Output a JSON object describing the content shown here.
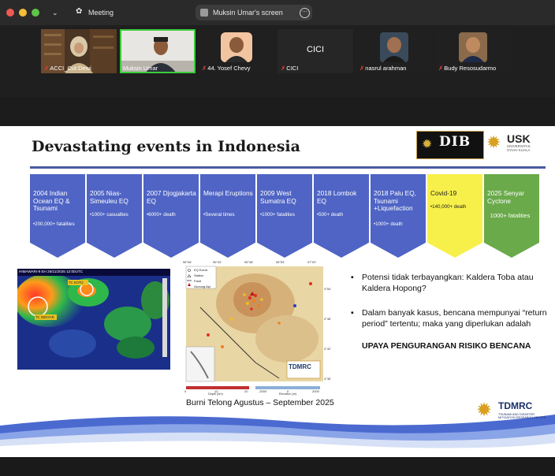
{
  "window": {
    "meeting_label": "Meeting",
    "share_title": "Muksin Umar's screen"
  },
  "participants": [
    {
      "name": "ACCI_Cut Dewi",
      "muted": true
    },
    {
      "name": "Muksin Umar",
      "muted": false
    },
    {
      "name": "44. Yosef Chevy",
      "muted": true
    },
    {
      "name": "CICI",
      "muted": true,
      "center_label": "CICI"
    },
    {
      "name": "nasrul arahman",
      "muted": true
    },
    {
      "name": "Budy Resosudarmo",
      "muted": true
    }
  ],
  "slide": {
    "title": "Devastating events in Indonesia",
    "logos": {
      "dib": "DIB",
      "usk": "USK",
      "usk_sub": "UNIVERSITAS SYIAH KUALA",
      "tdmrc": "TDMRC",
      "tdmrc_sub": "TSUNAMI AND DISASTER MITIGATION RESEARCH CENTER"
    },
    "events": [
      {
        "title": "2004 Indian Ocean EQ & Tsunami",
        "detail": "•200,000+ fatalities",
        "color": "#4f64c4"
      },
      {
        "title": "2005 Nias-Simeuleu EQ",
        "detail": "•1000+ casualties",
        "color": "#4f64c4"
      },
      {
        "title": "2007 Djogjakarta EQ",
        "detail": "•6000+ death",
        "color": "#4f64c4"
      },
      {
        "title": "Merapi Eruptions",
        "detail": "•Several times",
        "color": "#4f64c4"
      },
      {
        "title": "2009 West Sumatra EQ",
        "detail": "•1000+ fatalities",
        "color": "#4f64c4"
      },
      {
        "title": "2018 Lombok EQ",
        "detail": "•500+ death",
        "color": "#4f64c4"
      },
      {
        "title": "2018 Palu EQ, Tsunami +Liquefaction",
        "detail": "•1000+ death",
        "color": "#4f64c4"
      },
      {
        "title": "Covid-19",
        "detail": "•140,000+ death",
        "color": "#f7f04a"
      },
      {
        "title": "2025 Senyar Cyclone",
        "detail": "1000+ fatalities",
        "color": "#6aaa4a"
      }
    ],
    "satellite": {
      "header": "HIMAWARI-9 EH 26/11/2025 12:00UTC",
      "tc_label_1": "TC KOTO",
      "tc_label_2": "TC SENYAR"
    },
    "map": {
      "lon_ticks": [
        "96°36'",
        "96°42'",
        "96°48'",
        "96°54'",
        "97°00'"
      ],
      "lat_ticks": [
        "4°54'",
        "4°48'",
        "4°42'",
        "4°36'"
      ],
      "legend": [
        "EQ Event",
        "Station",
        "Fault",
        "Gunung Api"
      ],
      "depth_ticks": [
        "0",
        "10",
        "20"
      ],
      "depth_label": "Depth (km)",
      "elev_ticks": [
        "-2000",
        "0",
        "2000"
      ],
      "elev_label": "Elevation (m)",
      "badge": "TDMRC"
    },
    "caption": "Burni Telong Agustus – September 2025",
    "bullets": [
      "Potensi tidak terbayangkan: Kaldera Toba atau Kaldera Hopong?",
      "Dalam banyak kasus, bencana mempunyai “return period” tertentu; maka yang diperlukan adalah"
    ],
    "emphasis": "UPAYA PENGURANGAN RISIKO BENCANA"
  }
}
